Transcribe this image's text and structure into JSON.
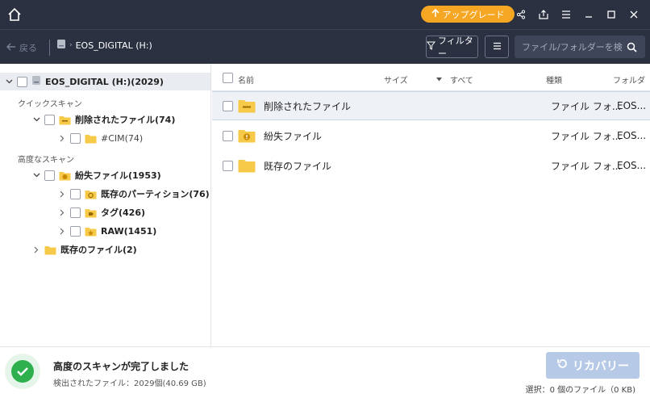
{
  "topbar": {
    "upgrade_label": "アップグレード",
    "icons": [
      "home-icon",
      "share-icon",
      "export-icon",
      "menu-icon",
      "minimize-icon",
      "maximize-icon",
      "close-icon"
    ]
  },
  "toolbar": {
    "back_label": "戻る",
    "breadcrumb": "EOS_DIGITAL (H:)",
    "filter_label": "フィルター",
    "search_placeholder": "ファイル/フォルダーを検索"
  },
  "tree": {
    "drive": "EOS_DIGITAL (H:)(2029)",
    "quick_scan_label": "クイックスキャン",
    "deleted": "削除されたファイル(74)",
    "cim": "#CIM(74)",
    "advanced_scan_label": "高度なスキャン",
    "lost": "紛失ファイル(1953)",
    "partition": "既存のパーティション(76)",
    "tag": "タグ(426)",
    "raw": "RAW(1451)",
    "existing": "既存のファイル(2)"
  },
  "table": {
    "headers": {
      "name": "名前",
      "size": "サイズ",
      "all": "すべて",
      "type": "種類",
      "folder": "フォルダ"
    },
    "rows": [
      {
        "name": "削除されたファイル",
        "type": "ファイル フォ...",
        "folder": "EOS..."
      },
      {
        "name": "紛失ファイル",
        "type": "ファイル フォ...",
        "folder": "EOS..."
      },
      {
        "name": "既存のファイル",
        "type": "ファイル フォ...",
        "folder": "EOS..."
      }
    ]
  },
  "status": {
    "title": "高度のスキャンが完了しました",
    "subtitle": "検出されたファイル：2029個(40.69 GB)",
    "recover_label": "リカバリー",
    "selection_info": "選択：0 個のファイル（0 KB)"
  },
  "colors": {
    "header_bg": "#2b3141",
    "accent_orange": "#f5a623",
    "folder_yellow": "#f7c948",
    "success_green": "#2fb04f",
    "recover_disabled": "#b6c9e6"
  }
}
